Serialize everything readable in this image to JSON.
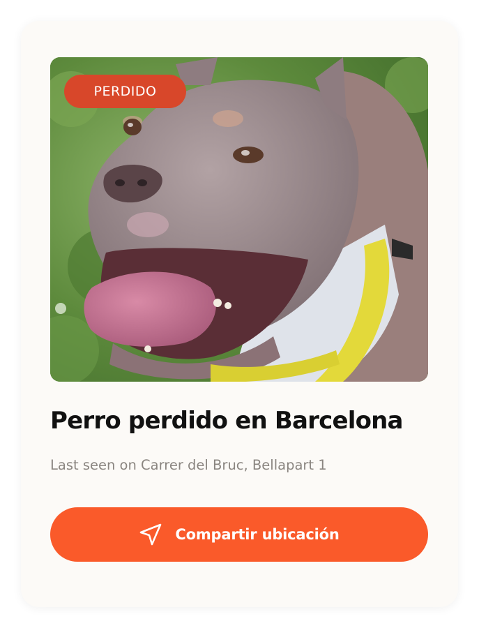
{
  "card": {
    "badge": "PERDIDO",
    "title": "Perro perdido en Barcelona",
    "subtitle": "Last seen on Carrer del Bruc, Bellapart 1",
    "cta_label": "Compartir ubicación",
    "cta_icon": "send-location-icon",
    "photo_subject": "dog-photo"
  },
  "colors": {
    "card_background": "#fcfaf7",
    "badge": "#d8472a",
    "cta": "#fa5a2a",
    "title": "#111111",
    "subtitle": "#8a8580"
  }
}
